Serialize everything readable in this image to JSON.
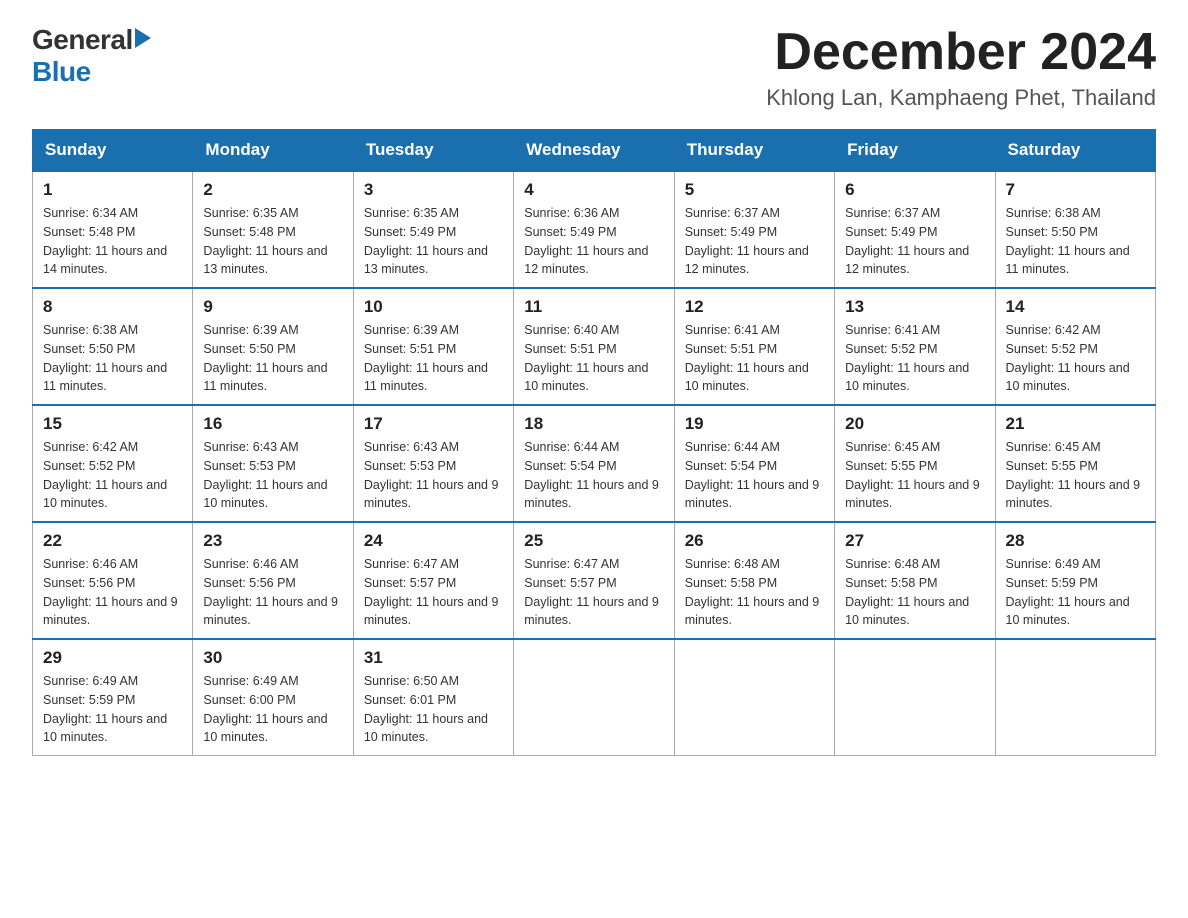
{
  "logo": {
    "general": "General",
    "blue": "Blue"
  },
  "title": "December 2024",
  "location": "Khlong Lan, Kamphaeng Phet, Thailand",
  "headers": [
    "Sunday",
    "Monday",
    "Tuesday",
    "Wednesday",
    "Thursday",
    "Friday",
    "Saturday"
  ],
  "weeks": [
    [
      {
        "day": "1",
        "sunrise": "6:34 AM",
        "sunset": "5:48 PM",
        "daylight": "11 hours and 14 minutes."
      },
      {
        "day": "2",
        "sunrise": "6:35 AM",
        "sunset": "5:48 PM",
        "daylight": "11 hours and 13 minutes."
      },
      {
        "day": "3",
        "sunrise": "6:35 AM",
        "sunset": "5:49 PM",
        "daylight": "11 hours and 13 minutes."
      },
      {
        "day": "4",
        "sunrise": "6:36 AM",
        "sunset": "5:49 PM",
        "daylight": "11 hours and 12 minutes."
      },
      {
        "day": "5",
        "sunrise": "6:37 AM",
        "sunset": "5:49 PM",
        "daylight": "11 hours and 12 minutes."
      },
      {
        "day": "6",
        "sunrise": "6:37 AM",
        "sunset": "5:49 PM",
        "daylight": "11 hours and 12 minutes."
      },
      {
        "day": "7",
        "sunrise": "6:38 AM",
        "sunset": "5:50 PM",
        "daylight": "11 hours and 11 minutes."
      }
    ],
    [
      {
        "day": "8",
        "sunrise": "6:38 AM",
        "sunset": "5:50 PM",
        "daylight": "11 hours and 11 minutes."
      },
      {
        "day": "9",
        "sunrise": "6:39 AM",
        "sunset": "5:50 PM",
        "daylight": "11 hours and 11 minutes."
      },
      {
        "day": "10",
        "sunrise": "6:39 AM",
        "sunset": "5:51 PM",
        "daylight": "11 hours and 11 minutes."
      },
      {
        "day": "11",
        "sunrise": "6:40 AM",
        "sunset": "5:51 PM",
        "daylight": "11 hours and 10 minutes."
      },
      {
        "day": "12",
        "sunrise": "6:41 AM",
        "sunset": "5:51 PM",
        "daylight": "11 hours and 10 minutes."
      },
      {
        "day": "13",
        "sunrise": "6:41 AM",
        "sunset": "5:52 PM",
        "daylight": "11 hours and 10 minutes."
      },
      {
        "day": "14",
        "sunrise": "6:42 AM",
        "sunset": "5:52 PM",
        "daylight": "11 hours and 10 minutes."
      }
    ],
    [
      {
        "day": "15",
        "sunrise": "6:42 AM",
        "sunset": "5:52 PM",
        "daylight": "11 hours and 10 minutes."
      },
      {
        "day": "16",
        "sunrise": "6:43 AM",
        "sunset": "5:53 PM",
        "daylight": "11 hours and 10 minutes."
      },
      {
        "day": "17",
        "sunrise": "6:43 AM",
        "sunset": "5:53 PM",
        "daylight": "11 hours and 9 minutes."
      },
      {
        "day": "18",
        "sunrise": "6:44 AM",
        "sunset": "5:54 PM",
        "daylight": "11 hours and 9 minutes."
      },
      {
        "day": "19",
        "sunrise": "6:44 AM",
        "sunset": "5:54 PM",
        "daylight": "11 hours and 9 minutes."
      },
      {
        "day": "20",
        "sunrise": "6:45 AM",
        "sunset": "5:55 PM",
        "daylight": "11 hours and 9 minutes."
      },
      {
        "day": "21",
        "sunrise": "6:45 AM",
        "sunset": "5:55 PM",
        "daylight": "11 hours and 9 minutes."
      }
    ],
    [
      {
        "day": "22",
        "sunrise": "6:46 AM",
        "sunset": "5:56 PM",
        "daylight": "11 hours and 9 minutes."
      },
      {
        "day": "23",
        "sunrise": "6:46 AM",
        "sunset": "5:56 PM",
        "daylight": "11 hours and 9 minutes."
      },
      {
        "day": "24",
        "sunrise": "6:47 AM",
        "sunset": "5:57 PM",
        "daylight": "11 hours and 9 minutes."
      },
      {
        "day": "25",
        "sunrise": "6:47 AM",
        "sunset": "5:57 PM",
        "daylight": "11 hours and 9 minutes."
      },
      {
        "day": "26",
        "sunrise": "6:48 AM",
        "sunset": "5:58 PM",
        "daylight": "11 hours and 9 minutes."
      },
      {
        "day": "27",
        "sunrise": "6:48 AM",
        "sunset": "5:58 PM",
        "daylight": "11 hours and 10 minutes."
      },
      {
        "day": "28",
        "sunrise": "6:49 AM",
        "sunset": "5:59 PM",
        "daylight": "11 hours and 10 minutes."
      }
    ],
    [
      {
        "day": "29",
        "sunrise": "6:49 AM",
        "sunset": "5:59 PM",
        "daylight": "11 hours and 10 minutes."
      },
      {
        "day": "30",
        "sunrise": "6:49 AM",
        "sunset": "6:00 PM",
        "daylight": "11 hours and 10 minutes."
      },
      {
        "day": "31",
        "sunrise": "6:50 AM",
        "sunset": "6:01 PM",
        "daylight": "11 hours and 10 minutes."
      },
      null,
      null,
      null,
      null
    ]
  ]
}
